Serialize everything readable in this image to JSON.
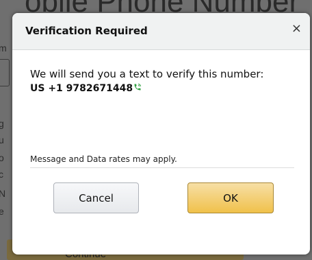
{
  "background": {
    "page_title": "obile Phone Number",
    "left_letters": [
      "m",
      "g",
      "u",
      "o",
      "c",
      "N",
      "e"
    ],
    "continue_label": "Continue"
  },
  "modal": {
    "title": "Verification Required",
    "close_glyph": "×",
    "message": "We will send you a text to verify this number:",
    "phone_number": "US +1 9782671448",
    "rates_note": "Message and Data rates may apply.",
    "cancel_label": "Cancel",
    "ok_label": "OK"
  },
  "icons": {
    "phone": "phone-icon"
  },
  "colors": {
    "ok_button": "#f0c14b",
    "ok_border": "#a88734",
    "cancel_button": "#e7e9ec",
    "header_bg": "#f0f2f2",
    "phone_icon": "#2e9e3f",
    "overlay": "#6f6f6f"
  }
}
